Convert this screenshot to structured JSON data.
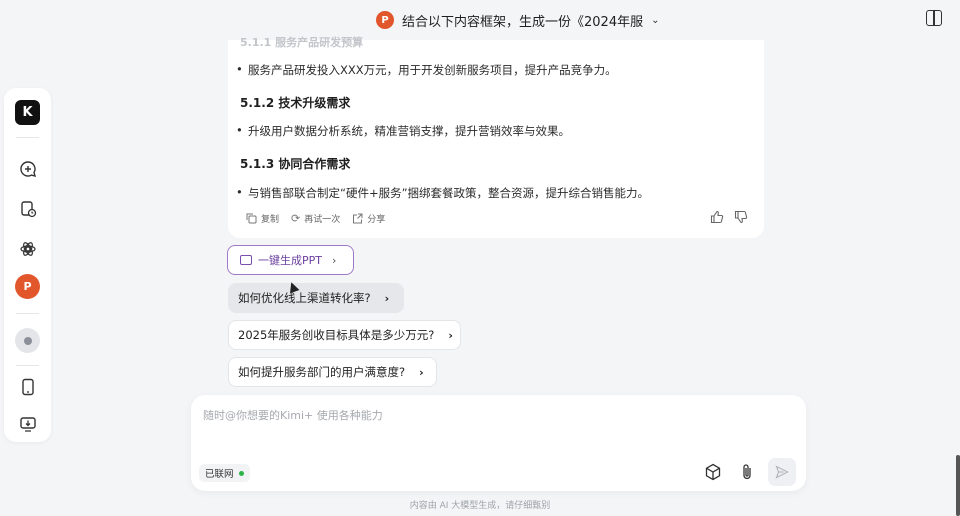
{
  "header": {
    "title": "结合以下内容框架，生成一份《2024年服",
    "badge": "P"
  },
  "sidebar": {
    "logo": "K",
    "ppt_label": "P"
  },
  "message": {
    "faded_heading": "5.1.1 服务产品研发预算",
    "bullet1": "服务产品研发投入XXX万元，用于开发创新服务项目，提升产品竞争力。",
    "heading2": "5.1.2 技术升级需求",
    "bullet2": "升级用户数据分析系统，精准营销支撑，提升营销效率与效果。",
    "heading3": "5.1.3 协同合作需求",
    "bullet3": "与销售部联合制定“硬件+服务”捆绑套餐政策，整合资源，提升综合销售能力。",
    "actions": {
      "copy": "复制",
      "retry": "再试一次",
      "share": "分享"
    }
  },
  "ppt_button": {
    "label": "一键生成PPT"
  },
  "suggestions": [
    {
      "text": "如何优化线上渠道转化率?"
    },
    {
      "text": "2025年服务创收目标具体是多少万元?"
    },
    {
      "text": "如何提升服务部门的用户满意度?"
    }
  ],
  "input": {
    "placeholder": "随时@你想要的Kimi+ 使用各种能力",
    "status": "已联网"
  },
  "footer": {
    "disclaimer": "内容由 AI 大模型生成，请仔细甄别"
  },
  "colors": {
    "accent": "#6b3fa0",
    "ppt": "#e2562b",
    "online": "#2bb34a"
  }
}
